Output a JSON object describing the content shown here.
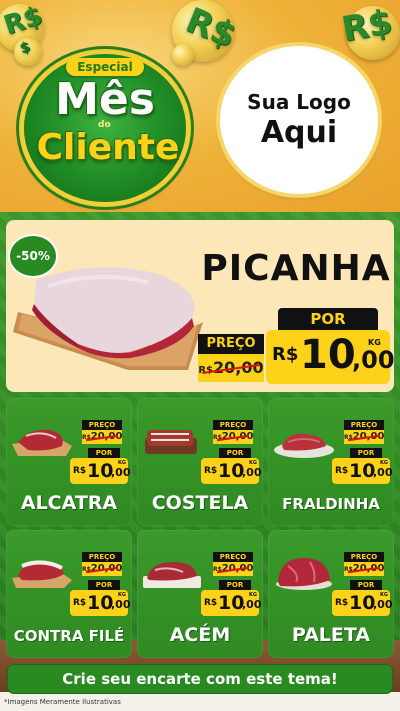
{
  "header": {
    "badge_especial": "Especial",
    "badge_mes": "Mês",
    "badge_do": "do",
    "badge_cliente": "Cliente",
    "currency_symbol": "R$",
    "logo_line1": "Sua Logo",
    "logo_line2": "Aqui"
  },
  "hero": {
    "discount": "-50%",
    "name": "PICANHA",
    "preco_label": "PREÇO",
    "old_currency": "R$",
    "old_price": "20,00",
    "por_label": "POR",
    "new_currency": "R$",
    "new_price_int": "10",
    "new_price_dec": ",00",
    "unit": "KG"
  },
  "products": [
    {
      "name": "ALCATRA",
      "preco_label": "PREÇO",
      "old_currency": "R$",
      "old_price": "20,00",
      "por_label": "POR",
      "currency": "R$",
      "price_int": "10",
      "price_dec": ",00",
      "unit": "KG"
    },
    {
      "name": "COSTELA",
      "preco_label": "PREÇO",
      "old_currency": "R$",
      "old_price": "20,00",
      "por_label": "POR",
      "currency": "R$",
      "price_int": "10",
      "price_dec": ",00",
      "unit": "KG"
    },
    {
      "name": "FRALDINHA",
      "preco_label": "PREÇO",
      "old_currency": "R$",
      "old_price": "20,00",
      "por_label": "POR",
      "currency": "R$",
      "price_int": "10",
      "price_dec": ",00",
      "unit": "KG"
    },
    {
      "name": "CONTRA FILÉ",
      "preco_label": "PREÇO",
      "old_currency": "R$",
      "old_price": "20,00",
      "por_label": "POR",
      "currency": "R$",
      "price_int": "10",
      "price_dec": ",00",
      "unit": "KG"
    },
    {
      "name": "ACÉM",
      "preco_label": "PREÇO",
      "old_currency": "R$",
      "old_price": "20,00",
      "por_label": "POR",
      "currency": "R$",
      "price_int": "10",
      "price_dec": ",00",
      "unit": "KG"
    },
    {
      "name": "PALETA",
      "preco_label": "PREÇO",
      "old_currency": "R$",
      "old_price": "20,00",
      "por_label": "POR",
      "currency": "R$",
      "price_int": "10",
      "price_dec": ",00",
      "unit": "KG"
    }
  ],
  "footer": {
    "cta": "Crie seu encarte com este tema!",
    "note": "*Imagens Meramente Ilustrativas"
  },
  "colors": {
    "brand_green": "#2f8a22",
    "price_yellow": "#ffd21a",
    "header_gold": "#efb33a",
    "hero_cream": "#fbe7b8"
  }
}
